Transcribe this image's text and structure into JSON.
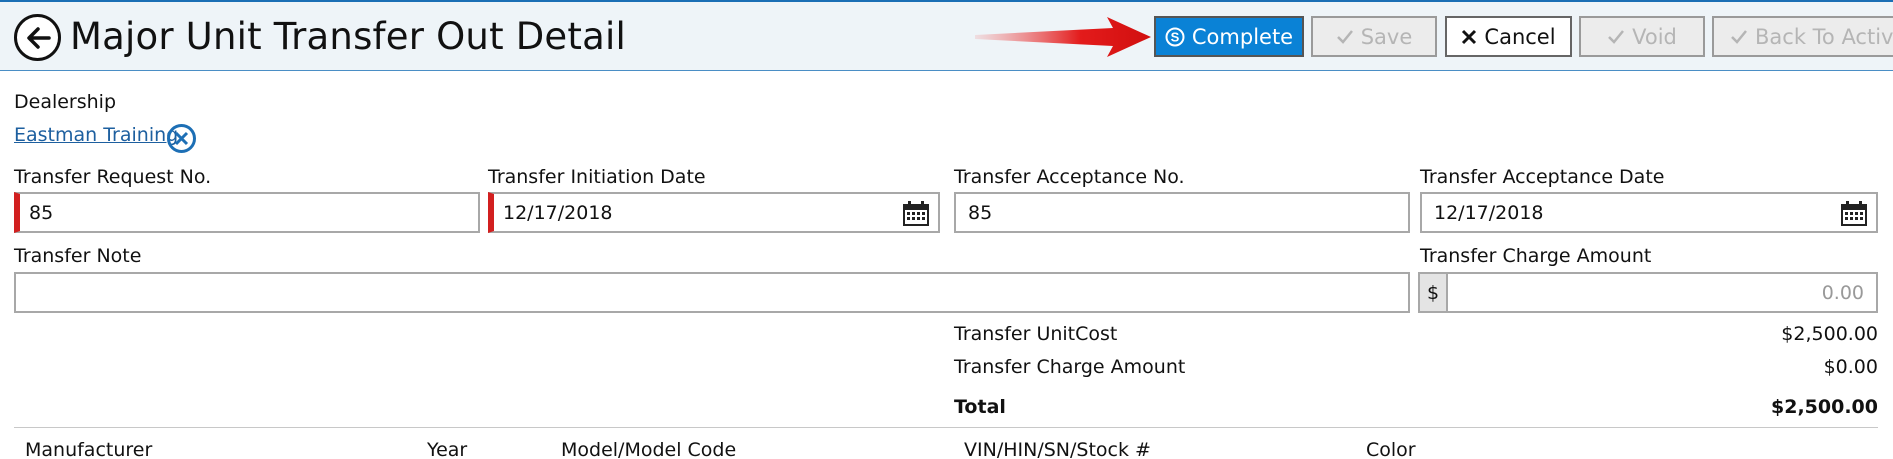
{
  "header": {
    "title": "Major Unit Transfer Out Detail",
    "buttons": {
      "complete": "Complete",
      "save": "Save",
      "cancel": "Cancel",
      "void": "Void",
      "back_to_active": "Back To Active"
    },
    "colors": {
      "primary": "#0a82d6",
      "arrow": "#e31b1b",
      "required": "#d21f1f"
    }
  },
  "form": {
    "dealership_label": "Dealership",
    "dealership_value": "Eastman Training",
    "transfer_request_no_label": "Transfer Request No.",
    "transfer_request_no_value": "85",
    "transfer_initiation_date_label": "Transfer Initiation Date",
    "transfer_initiation_date_value": "12/17/2018",
    "transfer_acceptance_no_label": "Transfer Acceptance No.",
    "transfer_acceptance_no_value": "85",
    "transfer_acceptance_date_label": "Transfer Acceptance Date",
    "transfer_acceptance_date_value": "12/17/2018",
    "transfer_note_label": "Transfer Note",
    "transfer_note_value": "",
    "transfer_charge_amount_label": "Transfer Charge Amount",
    "currency_symbol": "$",
    "transfer_charge_amount_value": "0.00"
  },
  "summary": {
    "unit_cost_label": "Transfer UnitCost",
    "unit_cost_value": "$2,500.00",
    "charge_amount_label": "Transfer Charge Amount",
    "charge_amount_value": "$0.00",
    "total_label": "Total",
    "total_value": "$2,500.00"
  },
  "table": {
    "columns": [
      "Manufacturer",
      "Year",
      "Model/Model Code",
      "VIN/HIN/SN/Stock #",
      "Color"
    ]
  },
  "icons": [
    "back-arrow-icon",
    "complete-circle-s-icon",
    "checkmark-icon",
    "x-icon",
    "calendar-icon",
    "clear-circle-x-icon",
    "red-arrow-icon"
  ]
}
